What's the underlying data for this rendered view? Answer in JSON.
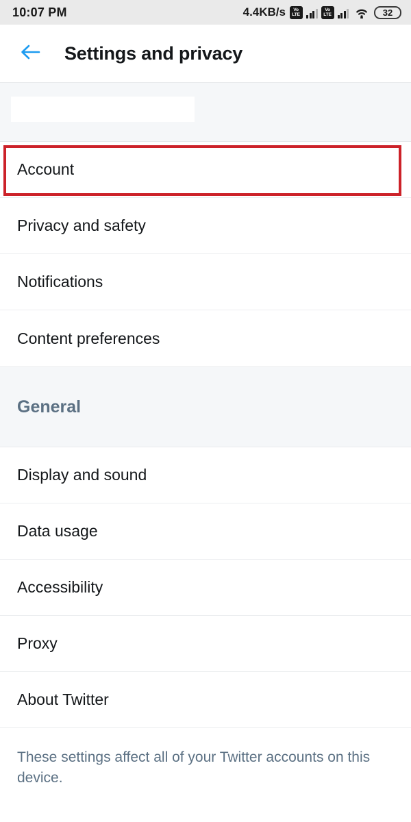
{
  "status_bar": {
    "clock": "10:07 PM",
    "network_speed": "4.4KB/s",
    "volte_top": "Vo",
    "volte_bottom": "LTE",
    "battery_level": "32",
    "icons": [
      "volte-icon",
      "signal-bars-icon",
      "wifi-icon",
      "battery-icon"
    ]
  },
  "header": {
    "back_icon": "back-arrow-icon",
    "title": "Settings and privacy",
    "accent_color": "#1d9bf0"
  },
  "account_banner": {
    "redacted": true
  },
  "account_group": {
    "items": [
      {
        "label": "Account",
        "highlighted": true
      },
      {
        "label": "Privacy and safety",
        "highlighted": false
      },
      {
        "label": "Notifications",
        "highlighted": false
      },
      {
        "label": "Content preferences",
        "highlighted": false
      }
    ]
  },
  "general_section": {
    "title": "General",
    "items": [
      {
        "label": "Display and sound"
      },
      {
        "label": "Data usage"
      },
      {
        "label": "Accessibility"
      },
      {
        "label": "Proxy"
      },
      {
        "label": "About Twitter"
      }
    ]
  },
  "footer": {
    "note": "These settings affect all of your Twitter accounts on this device."
  },
  "annotation": {
    "color": "#cc2229",
    "target": "Account"
  }
}
